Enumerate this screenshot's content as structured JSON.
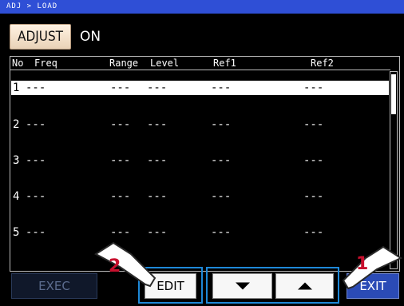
{
  "breadcrumb": "ADJ > LOAD",
  "adjust": {
    "button_label": "ADJUST",
    "state": "ON"
  },
  "table": {
    "headers": {
      "no": "No",
      "freq": "Freq",
      "range": "Range",
      "level": "Level",
      "ref1": "Ref1",
      "ref2": "Ref2"
    },
    "rows": [
      {
        "no": "1",
        "freq": "---",
        "range": "---",
        "level": "---",
        "ref1": "---",
        "ref2": "---",
        "selected": true
      },
      {
        "no": "2",
        "freq": "---",
        "range": "---",
        "level": "---",
        "ref1": "---",
        "ref2": "---",
        "selected": false
      },
      {
        "no": "3",
        "freq": "---",
        "range": "---",
        "level": "---",
        "ref1": "---",
        "ref2": "---",
        "selected": false
      },
      {
        "no": "4",
        "freq": "---",
        "range": "---",
        "level": "---",
        "ref1": "---",
        "ref2": "---",
        "selected": false
      },
      {
        "no": "5",
        "freq": "---",
        "range": "---",
        "level": "---",
        "ref1": "---",
        "ref2": "---",
        "selected": false
      }
    ]
  },
  "buttons": {
    "exec": "EXEC",
    "edit": "EDIT",
    "exit": "EXIT"
  },
  "callouts": {
    "first": "1",
    "second": "2"
  },
  "icons": {
    "down": "down-arrow-icon",
    "up": "up-arrow-icon"
  },
  "colors": {
    "accent": "#2f4fd6",
    "highlight_frame": "#1e88d8"
  }
}
